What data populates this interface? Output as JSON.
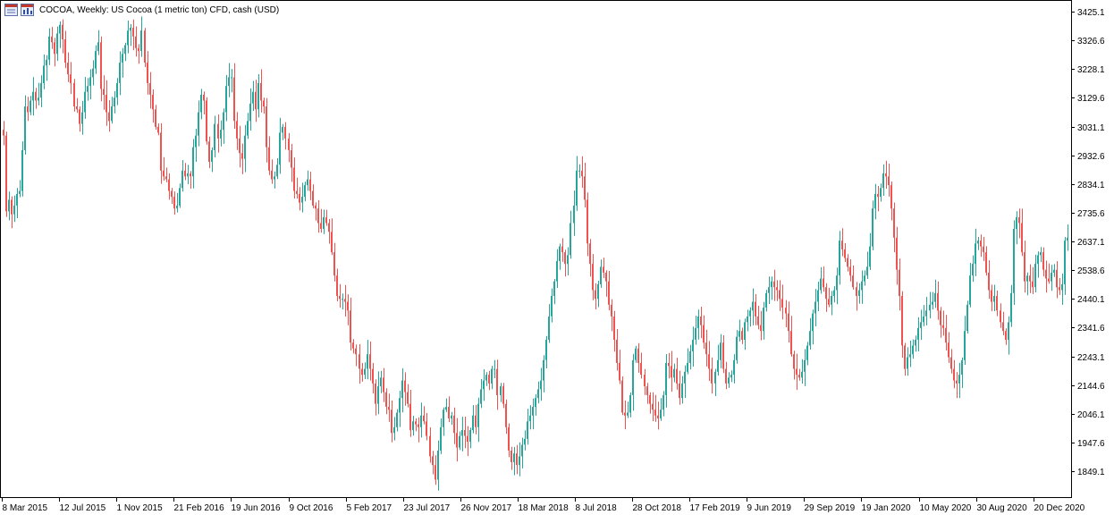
{
  "header": {
    "title": "COCOA, Weekly:  US Cocoa (1 metric ton) CFD, cash (USD)"
  },
  "icons": [
    "grid-icon",
    "chart-icon"
  ],
  "colors": {
    "up": "#26a69a",
    "down": "#ef5350",
    "axis": "#000000",
    "background": "#ffffff"
  },
  "chart_data": {
    "type": "candlestick",
    "title": "COCOA, Weekly:  US Cocoa (1 metric ton) CFD, cash (USD)",
    "xlabel": "",
    "ylabel": "",
    "ylim": [
      1750,
      3460
    ],
    "yticks": [
      "3425.1",
      "3326.6",
      "3228.1",
      "3129.6",
      "3031.1",
      "2932.6",
      "2834.1",
      "2735.6",
      "2637.1",
      "2538.6",
      "2440.1",
      "2341.6",
      "2243.1",
      "2144.6",
      "2046.1",
      "1947.6",
      "1849.1"
    ],
    "xticks": [
      "8 Mar 2015",
      "12 Jul 2015",
      "1 Nov 2015",
      "21 Feb 2016",
      "19 Jun 2016",
      "9 Oct 2016",
      "5 Feb 2017",
      "23 Jul 2017",
      "26 Nov 2017",
      "18 Mar 2018",
      "8 Jul 2018",
      "28 Oct 2018",
      "17 Feb 2019",
      "9 Jun 2019",
      "29 Sep 2019",
      "19 Jan 2020",
      "10 May 2020",
      "30 Aug 2020",
      "20 Dec 2020"
    ],
    "grid": false,
    "closes": [
      3000,
      2740,
      2780,
      2730,
      2760,
      2800,
      2810,
      2950,
      3100,
      3080,
      3120,
      3150,
      3120,
      3130,
      3180,
      3240,
      3260,
      3340,
      3320,
      3280,
      3350,
      3380,
      3330,
      3250,
      3210,
      3180,
      3100,
      3090,
      3040,
      3080,
      3150,
      3170,
      3200,
      3230,
      3290,
      3320,
      3160,
      3140,
      3080,
      3050,
      3100,
      3130,
      3180,
      3250,
      3280,
      3310,
      3360,
      3370,
      3340,
      3300,
      3290,
      3360,
      3250,
      3180,
      3140,
      3090,
      3030,
      3010,
      2880,
      2860,
      2850,
      2810,
      2790,
      2750,
      2760,
      2820,
      2880,
      2860,
      2870,
      2860,
      2960,
      3000,
      3080,
      3140,
      3120,
      2980,
      2910,
      2950,
      3040,
      2990,
      3020,
      3080,
      3170,
      3200,
      3200,
      3050,
      2990,
      2940,
      2920,
      3000,
      3050,
      3110,
      3150,
      3090,
      3180,
      3120,
      3100,
      2960,
      2880,
      2850,
      2860,
      2900,
      3010,
      3030,
      2990,
      2950,
      2890,
      2810,
      2800,
      2770,
      2790,
      2830,
      2850,
      2810,
      2760,
      2750,
      2700,
      2680,
      2720,
      2700,
      2670,
      2600,
      2520,
      2450,
      2440,
      2440,
      2430,
      2400,
      2290,
      2270,
      2250,
      2200,
      2180,
      2200,
      2250,
      2200,
      2150,
      2080,
      2140,
      2170,
      2120,
      2070,
      2060,
      1980,
      2000,
      2050,
      2100,
      2160,
      2120,
      2080,
      1990,
      2020,
      2010,
      2000,
      2040,
      2020,
      1970,
      1900,
      1870,
      1820,
      1920,
      2000,
      2060,
      2070,
      2030,
      2040,
      1980,
      1930,
      1970,
      1990,
      1970,
      1950,
      1990,
      2040,
      2000,
      2080,
      2130,
      2160,
      2180,
      2150,
      2200,
      2200,
      2110,
      2140,
      2080,
      2000,
      1920,
      1880,
      1910,
      1870,
      1900,
      1940,
      1960,
      2020,
      2040,
      2070,
      2100,
      2130,
      2160,
      2230,
      2300,
      2380,
      2450,
      2500,
      2570,
      2620,
      2600,
      2560,
      2590,
      2700,
      2760,
      2880,
      2880,
      2860,
      2780,
      2630,
      2560,
      2470,
      2440,
      2490,
      2550,
      2530,
      2500,
      2420,
      2380,
      2300,
      2220,
      2160,
      2050,
      2040,
      2050,
      2110,
      2230,
      2270,
      2220,
      2180,
      2140,
      2110,
      2080,
      2060,
      2040,
      2030,
      2060,
      2110,
      2220,
      2210,
      2170,
      2200,
      2150,
      2100,
      2150,
      2190,
      2220,
      2260,
      2300,
      2340,
      2380,
      2350,
      2290,
      2250,
      2200,
      2150,
      2190,
      2230,
      2290,
      2200,
      2150,
      2170,
      2180,
      2230,
      2310,
      2330,
      2300,
      2360,
      2380,
      2400,
      2430,
      2380,
      2350,
      2330,
      2410,
      2460,
      2480,
      2500,
      2480,
      2470,
      2440,
      2410,
      2390,
      2330,
      2250,
      2200,
      2180,
      2170,
      2190,
      2230,
      2280,
      2330,
      2390,
      2430,
      2470,
      2510,
      2480,
      2440,
      2420,
      2450,
      2470,
      2520,
      2640,
      2610,
      2580,
      2550,
      2520,
      2480,
      2450,
      2470,
      2500,
      2520,
      2550,
      2620,
      2750,
      2800,
      2790,
      2820,
      2870,
      2860,
      2830,
      2750,
      2650,
      2540,
      2450,
      2280,
      2200,
      2240,
      2250,
      2280,
      2300,
      2340,
      2360,
      2380,
      2400,
      2420,
      2430,
      2460,
      2400,
      2350,
      2340,
      2290,
      2240,
      2200,
      2160,
      2150,
      2180,
      2230,
      2330,
      2420,
      2520,
      2560,
      2630,
      2640,
      2620,
      2600,
      2530,
      2470,
      2430,
      2450,
      2400,
      2360,
      2330,
      2300,
      2360,
      2460,
      2680,
      2720,
      2700,
      2600,
      2500,
      2520,
      2500,
      2480,
      2560,
      2590,
      2600,
      2540,
      2510,
      2500,
      2530,
      2540,
      2480,
      2470,
      2490,
      2640,
      2650
    ]
  }
}
